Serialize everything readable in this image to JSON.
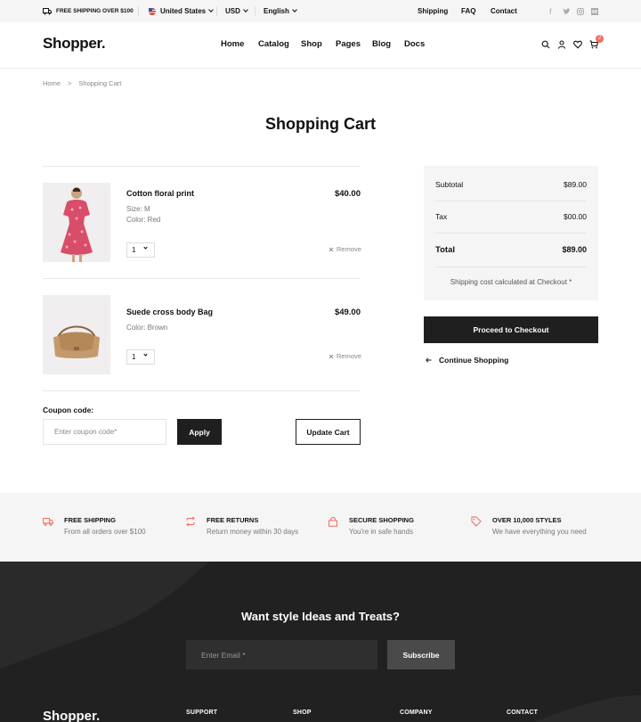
{
  "topbar": {
    "shipping_note": "FREE SHIPPING OVER $100",
    "country": "United States",
    "currency": "USD",
    "language": "English",
    "links": [
      "Shipping",
      "FAQ",
      "Contact"
    ],
    "social_icons": [
      "facebook-icon",
      "twitter-icon",
      "instagram-icon",
      "medium-icon"
    ]
  },
  "header": {
    "logo": "Shopper.",
    "nav": [
      "Home",
      "Catalog",
      "Shop",
      "Pages",
      "Blog",
      "Docs"
    ],
    "cart_count": "2",
    "icons": [
      "search-icon",
      "user-icon",
      "heart-icon",
      "cart-icon"
    ]
  },
  "breadcrumb": {
    "home": "Home",
    "separator": ">",
    "current": "Shopping Cart"
  },
  "page_title": "Shopping Cart",
  "cart": {
    "items": [
      {
        "name": "Cotton floral print",
        "size": "Size: M",
        "color": "Color: Red",
        "price": "$40.00",
        "qty": "1",
        "remove": "Remove"
      },
      {
        "name": "Suede cross body Bag",
        "color": "Color: Brown",
        "price": "$49.00",
        "qty": "1",
        "remove": "Remove"
      }
    ],
    "coupon_label": "Coupon code:",
    "coupon_placeholder": "Enter coupon code*",
    "apply": "Apply",
    "update": "Update Cart"
  },
  "summary": {
    "subtotal_label": "Subtotal",
    "subtotal": "$89.00",
    "tax_label": "Tax",
    "tax": "$00.00",
    "total_label": "Total",
    "total": "$89.00",
    "note": "Shipping cost calculated at Checkout *",
    "checkout": "Proceed to Checkout",
    "continue": "Continue Shopping"
  },
  "features": [
    {
      "title": "FREE SHIPPING",
      "subtitle": "From all orders over $100",
      "icon": "truck-icon"
    },
    {
      "title": "FREE RETURNS",
      "subtitle": "Return money within 30 days",
      "icon": "repeat-icon"
    },
    {
      "title": "SECURE SHOPPING",
      "subtitle": "You're in safe hands",
      "icon": "lock-icon"
    },
    {
      "title": "OVER 10,000 STYLES",
      "subtitle": "We have everything you need",
      "icon": "tag-icon"
    }
  ],
  "footer": {
    "newsletter_title": "Want style Ideas and Treats?",
    "email_placeholder": "Enter Email *",
    "subscribe": "Subscribe",
    "logo": "Shopper.",
    "columns": [
      "SUPPORT",
      "SHOP",
      "COMPANY",
      "CONTACT"
    ]
  },
  "colors": {
    "accent": "#f36b5f",
    "dark": "#1f1f1f",
    "footer_bg": "#212121",
    "light_bg": "#f5f5f5"
  }
}
